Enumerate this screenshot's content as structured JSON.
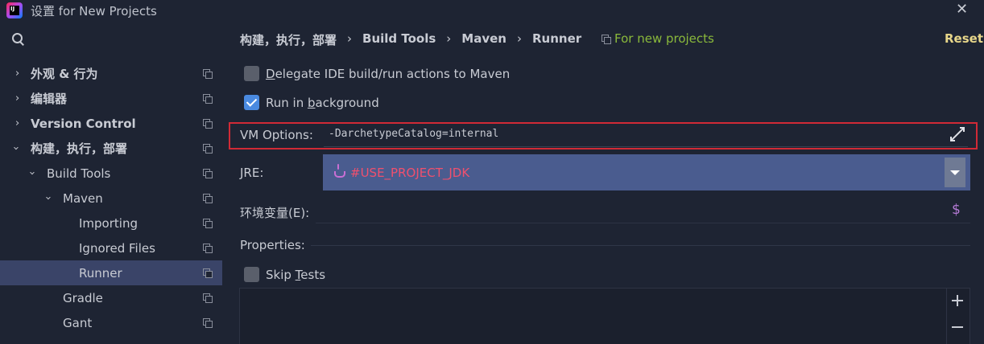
{
  "window": {
    "title": "设置 for New Projects",
    "app_icon_text": "IJ"
  },
  "sidebar": {
    "items": [
      {
        "label": "外观 & 行为",
        "expanded": false
      },
      {
        "label": "编辑器",
        "expanded": false
      },
      {
        "label": "Version Control",
        "expanded": false
      },
      {
        "label": "构建，执行，部署",
        "expanded": true
      },
      {
        "label": "Build Tools",
        "expanded": true
      },
      {
        "label": "Maven",
        "expanded": true
      },
      {
        "label": "Importing"
      },
      {
        "label": "Ignored Files"
      },
      {
        "label": "Runner",
        "selected": true
      },
      {
        "label": "Gradle"
      },
      {
        "label": "Gant"
      }
    ]
  },
  "breadcrumb": [
    "构建，执行，部署",
    "Build Tools",
    "Maven",
    "Runner"
  ],
  "breadcrumb_separator": "›",
  "scope_label": "For new projects",
  "reset_label": "Reset",
  "options": {
    "delegate": {
      "pre": "",
      "mnemonic": "D",
      "post": "elegate IDE build/run actions to Maven",
      "checked": false
    },
    "background": {
      "pre": "Run in ",
      "mnemonic": "b",
      "post": "ackground",
      "checked": true
    },
    "skip_tests": {
      "pre": "Skip ",
      "mnemonic": "T",
      "post": "ests",
      "checked": false
    }
  },
  "vm_options": {
    "label": "VM Options:",
    "value": "-DarchetypeCatalog=internal"
  },
  "jre": {
    "label": "JRE:",
    "value": "#USE_PROJECT_JDK"
  },
  "env": {
    "label": "环境变量(E):",
    "value": "",
    "icon_text": "$"
  },
  "properties_label": "Properties:",
  "colors": {
    "background": "#1e2433",
    "selection": "#3a4468",
    "highlight_border": "#d12a36",
    "scope_green": "#8ab93b",
    "reset_yellow": "#e7d68a",
    "jre_value": "#f0506e"
  },
  "icons": {
    "close": "close-icon",
    "search": "search-icon",
    "copy": "copy-icon",
    "expand": "expand-icon",
    "java": "java-icon",
    "dropdown": "chevron-down-icon",
    "dollar": "dollar-icon",
    "add": "plus-icon",
    "remove": "minus-icon"
  }
}
